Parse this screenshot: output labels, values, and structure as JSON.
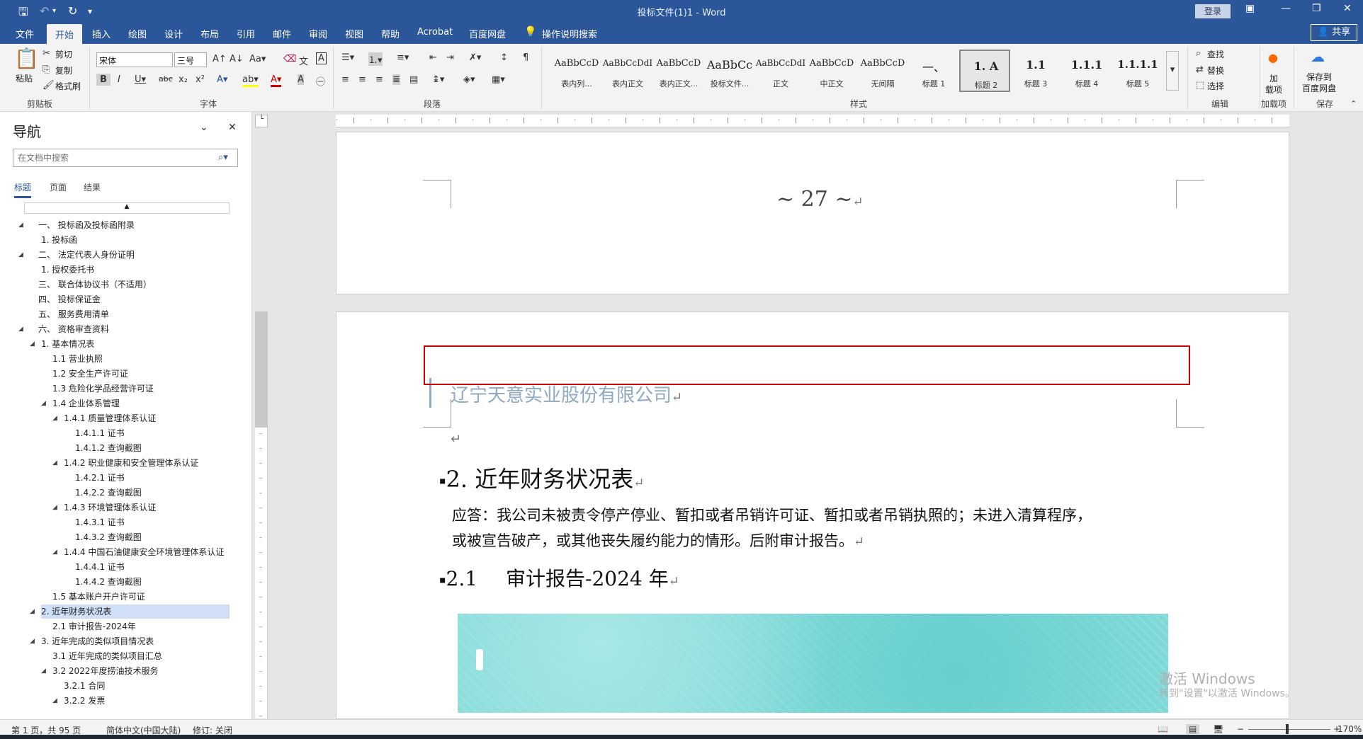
{
  "window": {
    "title": "投标文件(1)1  -  Word",
    "signin": "登录",
    "share": "共享"
  },
  "tabs": [
    "文件",
    "开始",
    "插入",
    "绘图",
    "设计",
    "布局",
    "引用",
    "邮件",
    "审阅",
    "视图",
    "帮助",
    "Acrobat",
    "百度网盘",
    "操作说明搜索"
  ],
  "ribbon": {
    "clipboard": {
      "paste": "粘贴",
      "cut": "剪切",
      "copy": "复制",
      "format_painter": "格式刷",
      "group": "剪贴板"
    },
    "font": {
      "name": "宋体",
      "size": "三号",
      "group": "字体"
    },
    "paragraph": {
      "group": "段落"
    },
    "styles": {
      "group": "样式",
      "items": [
        {
          "preview": "AaBbCcD",
          "label": "表内列..."
        },
        {
          "preview": "AaBbCcDdI",
          "label": "表内正文"
        },
        {
          "preview": "AaBbCcD",
          "label": "表内正文..."
        },
        {
          "preview": "AaBbCc",
          "label": "投标文件..."
        },
        {
          "preview": "AaBbCcDdI",
          "label": "正文"
        },
        {
          "preview": "AaBbCcD",
          "label": "中正文"
        },
        {
          "preview": "AaBbCcD",
          "label": "无间隔"
        },
        {
          "preview": "一、",
          "label": "标题 1"
        },
        {
          "preview": "1.  A",
          "label": "标题 2"
        },
        {
          "preview": "1.1",
          "label": "标题 3"
        },
        {
          "preview": "1.1.1",
          "label": "标题 4"
        },
        {
          "preview": "1.1.1.1",
          "label": "标题 5"
        }
      ]
    },
    "editing": {
      "find": "查找",
      "replace": "替换",
      "select": "选择",
      "group": "编辑"
    },
    "addins": {
      "label1": "加",
      "label2": "载项",
      "group": "加载项"
    },
    "save": {
      "label1": "保存到",
      "label2": "百度网盘",
      "group": "保存"
    }
  },
  "nav": {
    "title": "导航",
    "search_placeholder": "在文档中搜索",
    "tabs": [
      "标题",
      "页面",
      "结果"
    ],
    "items": [
      {
        "text": "一、  投标函及投标函附录",
        "level": 0,
        "tri": true
      },
      {
        "text": "1. 投标函",
        "level": 1,
        "tri": false
      },
      {
        "text": "二、  法定代表人身份证明",
        "level": 0,
        "tri": true
      },
      {
        "text": "1. 授权委托书",
        "level": 1,
        "tri": false
      },
      {
        "text": "三、  联合体协议书（不适用）",
        "level": 0,
        "tri": false
      },
      {
        "text": "四、  投标保证金",
        "level": 0,
        "tri": false
      },
      {
        "text": "五、  服务费用清单",
        "level": 0,
        "tri": false
      },
      {
        "text": "六、  资格审查资料",
        "level": 0,
        "tri": true
      },
      {
        "text": "1. 基本情况表",
        "level": 1,
        "tri": true
      },
      {
        "text": "1.1 营业执照",
        "level": 2,
        "tri": false
      },
      {
        "text": "1.2 安全生产许可证",
        "level": 2,
        "tri": false
      },
      {
        "text": "1.3 危险化学品经营许可证",
        "level": 2,
        "tri": false
      },
      {
        "text": "1.4 企业体系管理",
        "level": 2,
        "tri": true
      },
      {
        "text": "1.4.1 质量管理体系认证",
        "level": 3,
        "tri": true
      },
      {
        "text": "1.4.1.1 证书",
        "level": 4,
        "tri": false
      },
      {
        "text": "1.4.1.2 查询截图",
        "level": 4,
        "tri": false
      },
      {
        "text": "1.4.2 职业健康和安全管理体系认证",
        "level": 3,
        "tri": true
      },
      {
        "text": "1.4.2.1 证书",
        "level": 4,
        "tri": false
      },
      {
        "text": "1.4.2.2 查询截图",
        "level": 4,
        "tri": false
      },
      {
        "text": "1.4.3 环境管理体系认证",
        "level": 3,
        "tri": true
      },
      {
        "text": "1.4.3.1 证书",
        "level": 4,
        "tri": false
      },
      {
        "text": "1.4.3.2 查询截图",
        "level": 4,
        "tri": false
      },
      {
        "text": "1.4.4 中国石油健康安全环境管理体系认证",
        "level": 3,
        "tri": true
      },
      {
        "text": "1.4.4.1 证书",
        "level": 4,
        "tri": false
      },
      {
        "text": "1.4.4.2 查询截图",
        "level": 4,
        "tri": false
      },
      {
        "text": "1.5 基本账户开户许可证",
        "level": 2,
        "tri": false
      },
      {
        "text": "2. 近年财务状况表",
        "level": 1,
        "tri": true,
        "selected": true
      },
      {
        "text": "2.1 审计报告-2024年",
        "level": 2,
        "tri": false
      },
      {
        "text": "3. 近年完成的类似项目情况表",
        "level": 1,
        "tri": true
      },
      {
        "text": "3.1 近年完成的类似项目汇总",
        "level": 2,
        "tri": false
      },
      {
        "text": "3.2 2022年度捞油技术服务",
        "level": 2,
        "tri": true
      },
      {
        "text": "3.2.1 合同",
        "level": 3,
        "tri": false
      },
      {
        "text": "3.2.2 发票",
        "level": 3,
        "tri": true
      }
    ]
  },
  "document": {
    "page_number": "~ 27 ~",
    "company": "辽宁天意实业股份有限公司",
    "heading1": "2. 近年财务状况表",
    "para1": "应答：我公司未被责令停产停业、暂扣或者吊销许可证、暂扣或者吊销执照的；未进入清算程序，",
    "para2": "或被宣告破产，或其他丧失履约能力的情形。后附审计报告。",
    "heading2_num": "2.1",
    "heading2_text": "审计报告-2024 年"
  },
  "watermark": {
    "line1": "激活 Windows",
    "line2": "转到\"设置\"以激活 Windows。"
  },
  "status": {
    "page": "第 1 页，共 95 页",
    "lang": "简体中文(中国大陆)",
    "track": "修订: 关闭",
    "zoom": "170%"
  }
}
